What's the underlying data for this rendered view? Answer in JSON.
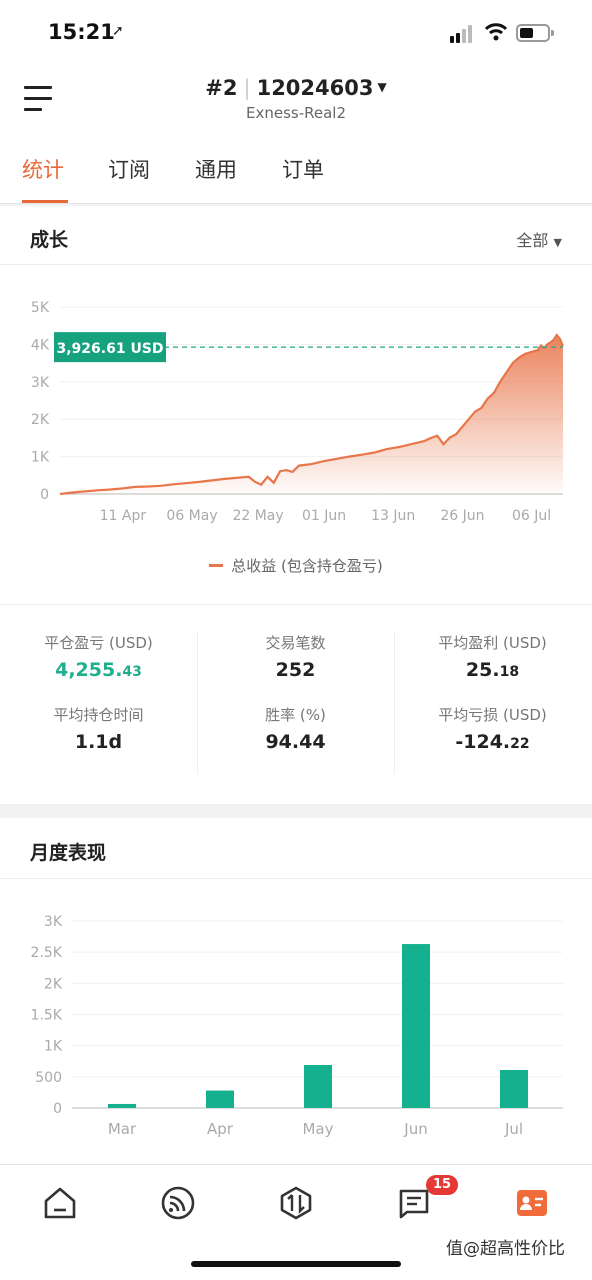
{
  "status": {
    "time": "15:21"
  },
  "header": {
    "account_prefix": "#2",
    "account_number": "12024603",
    "server": "Exness-Real2"
  },
  "tabs": [
    {
      "label": "统计",
      "active": true
    },
    {
      "label": "订阅",
      "active": false
    },
    {
      "label": "通用",
      "active": false
    },
    {
      "label": "订单",
      "active": false
    }
  ],
  "growth": {
    "title": "成长",
    "filter": "全部",
    "current_label": "3,926.61 USD",
    "legend": "总收益 (包含持仓盈亏)"
  },
  "stats": [
    {
      "label": "平仓盈亏 (USD)",
      "int": "4,255.",
      "dec": "43",
      "green": true
    },
    {
      "label": "交易笔数",
      "int": "252",
      "dec": ""
    },
    {
      "label": "平均盈利 (USD)",
      "int": "25.",
      "dec": "18"
    },
    {
      "label": "平均持仓时间",
      "int": "1.1d",
      "dec": ""
    },
    {
      "label": "胜率 (%)",
      "int": "94.44",
      "dec": ""
    },
    {
      "label": "平均亏损 (USD)",
      "int": "-124.",
      "dec": "22"
    }
  ],
  "monthly": {
    "title": "月度表现"
  },
  "chart_data": [
    {
      "type": "area",
      "series": [
        {
          "values": [
            [
              0,
              0
            ],
            [
              4,
              40
            ],
            [
              8,
              70
            ],
            [
              12,
              100
            ],
            [
              16,
              120
            ],
            [
              20,
              150
            ],
            [
              24,
              190
            ],
            [
              28,
              200
            ],
            [
              32,
              220
            ],
            [
              36,
              260
            ],
            [
              40,
              290
            ],
            [
              44,
              320
            ],
            [
              48,
              360
            ],
            [
              52,
              400
            ],
            [
              56,
              430
            ],
            [
              60,
              460
            ],
            [
              62,
              330
            ],
            [
              64,
              250
            ],
            [
              66,
              460
            ],
            [
              68,
              300
            ],
            [
              70,
              610
            ],
            [
              72,
              640
            ],
            [
              74,
              590
            ],
            [
              76,
              760
            ],
            [
              80,
              800
            ],
            [
              84,
              880
            ],
            [
              88,
              940
            ],
            [
              92,
              1000
            ],
            [
              96,
              1050
            ],
            [
              100,
              1110
            ],
            [
              104,
              1200
            ],
            [
              108,
              1260
            ],
            [
              112,
              1340
            ],
            [
              116,
              1420
            ],
            [
              118,
              1500
            ],
            [
              120,
              1560
            ],
            [
              122,
              1330
            ],
            [
              124,
              1510
            ],
            [
              126,
              1600
            ],
            [
              128,
              1800
            ],
            [
              130,
              2000
            ],
            [
              132,
              2200
            ],
            [
              134,
              2300
            ],
            [
              136,
              2550
            ],
            [
              138,
              2700
            ],
            [
              140,
              3000
            ],
            [
              142,
              3250
            ],
            [
              144,
              3500
            ],
            [
              146,
              3650
            ],
            [
              148,
              3750
            ],
            [
              150,
              3800
            ],
            [
              152,
              3850
            ],
            [
              153,
              3970
            ],
            [
              154,
              3900
            ],
            [
              155,
              4000
            ],
            [
              156,
              4050
            ],
            [
              157,
              4120
            ],
            [
              158,
              4250
            ],
            [
              159,
              4150
            ],
            [
              160,
              3950
            ]
          ]
        }
      ],
      "x_ticks": [
        {
          "label": "11 Apr",
          "x": 20
        },
        {
          "label": "06 May",
          "x": 42
        },
        {
          "label": "22 May",
          "x": 63
        },
        {
          "label": "01 Jun",
          "x": 84
        },
        {
          "label": "13 Jun",
          "x": 106
        },
        {
          "label": "26 Jun",
          "x": 128
        },
        {
          "label": "06 Jul",
          "x": 150
        }
      ],
      "y_ticks": [
        "0",
        "1K",
        "2K",
        "3K",
        "4K",
        "5K"
      ],
      "xlim": [
        0,
        160
      ],
      "ylim": [
        0,
        5000
      ],
      "reference_value": 3926.61,
      "color": "#e8764a"
    },
    {
      "type": "bar",
      "categories": [
        "Mar",
        "Apr",
        "May",
        "Jun",
        "Jul"
      ],
      "values": [
        65,
        280,
        690,
        2630,
        610
      ],
      "y_ticks": [
        "0",
        "500",
        "1K",
        "1.5K",
        "2K",
        "2.5K",
        "3K"
      ],
      "ylim": [
        0,
        3000
      ],
      "color": "#15b08e"
    }
  ],
  "nav": {
    "badge": "15"
  },
  "watermark": "值@超高性价比"
}
